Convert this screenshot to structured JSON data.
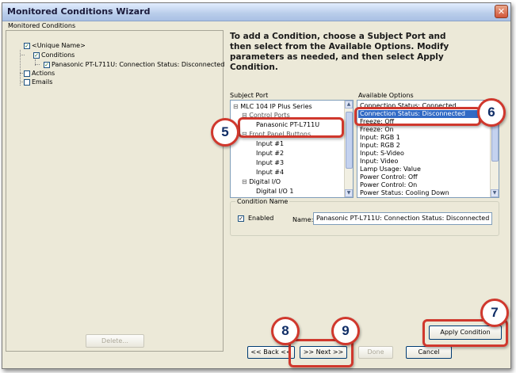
{
  "window": {
    "title": "Monitored Conditions Wizard",
    "close_glyph": "✕"
  },
  "left_panel": {
    "label": "Monitored Conditions",
    "tree": {
      "root": "<Unique Name>",
      "conditions": "Conditions",
      "condition_item": "Panasonic PT-L711U: Connection Status: Disconnected",
      "actions": "Actions",
      "emails": "Emails"
    },
    "delete_button": "Delete..."
  },
  "instruction": "To add a Condition, choose a Subject Port and then select from the Available Options. Modify parameters as needed, and then select Apply Condition.",
  "subject_port": {
    "label": "Subject Port",
    "items": [
      {
        "text": "MLC 104 IP Plus Series"
      },
      {
        "text": "Control Ports"
      },
      {
        "text": "Panasonic PT-L711U"
      },
      {
        "text": "Front Panel Buttons"
      },
      {
        "text": "Input #1"
      },
      {
        "text": "Input #2"
      },
      {
        "text": "Input #3"
      },
      {
        "text": "Input #4"
      },
      {
        "text": "Digital I/O"
      },
      {
        "text": "Digital I/O 1"
      }
    ]
  },
  "available_options": {
    "label": "Available Options",
    "items": [
      "Connection Status: Connected",
      "Connection Status: Disconnected",
      "Freeze: Off",
      "Freeze: On",
      "Input: RGB 1",
      "Input: RGB 2",
      "Input: S-Video",
      "Input: Video",
      "Lamp Usage: Value",
      "Power Control: Off",
      "Power Control: On",
      "Power Status: Cooling Down"
    ],
    "selected": "Connection Status: Disconnected"
  },
  "condition_name": {
    "legend": "Condition Name",
    "enabled_label": "Enabled",
    "enabled_checked": true,
    "name_label": "Name:",
    "name_value": "Panasonic PT-L711U: Connection Status: Disconnected"
  },
  "buttons": {
    "apply": "Apply Condition",
    "back": "<< Back <<",
    "next": ">> Next >>",
    "done": "Done",
    "cancel": "Cancel"
  },
  "callouts": [
    "5",
    "6",
    "7",
    "8",
    "9"
  ],
  "colors": {
    "callout_border": "#d0382d",
    "callout_text": "#0f2d66",
    "dialog_bg": "#ece9d8",
    "selection": "#316ac5"
  }
}
